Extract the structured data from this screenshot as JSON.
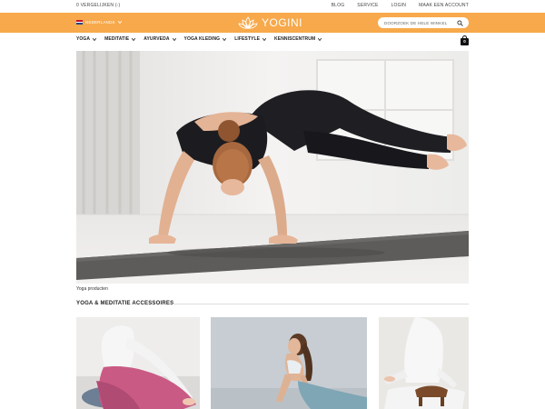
{
  "topbar": {
    "compare_label": "0 VERGELIJKEN (-)",
    "links": [
      "BLOG",
      "SERVICE",
      "LOGIN",
      "MAAK EEN ACCOUNT"
    ]
  },
  "header": {
    "language_label": "NEDERLANDS",
    "logo_text": "YOGINI",
    "search_placeholder": "DOORZOEK DE HELE WINKEL",
    "brand_color": "#f7a94b"
  },
  "nav": {
    "items": [
      "YOGA",
      "MEDITATIE",
      "AYURVEDA",
      "YOGA KLEDING",
      "LIFESTYLE",
      "KENNISCENTRUM"
    ],
    "cart_count": "0"
  },
  "hero": {
    "caption": "Yoga producten"
  },
  "section": {
    "title": "YOGA & MEDITATIE ACCESSOIRES"
  }
}
